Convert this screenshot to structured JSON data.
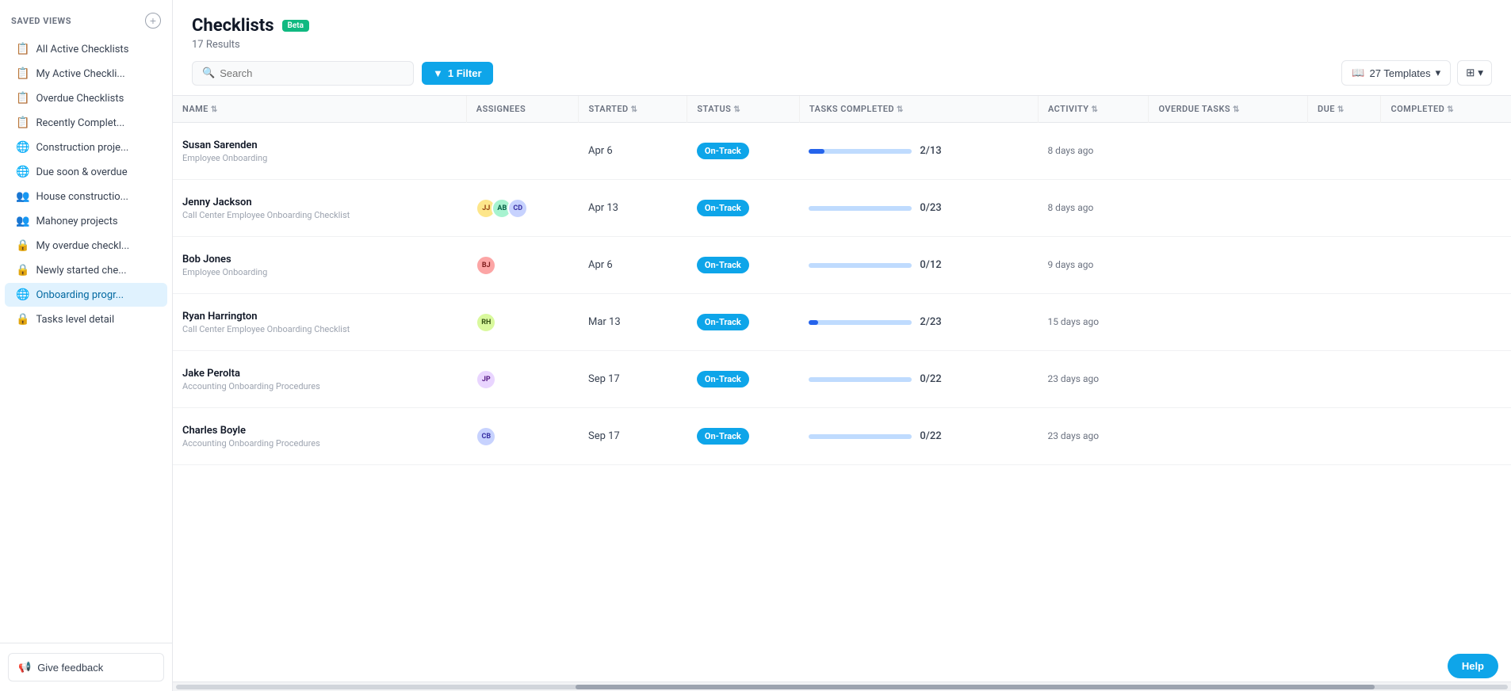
{
  "sidebar": {
    "header": "Saved Views",
    "add_icon": "+",
    "items": [
      {
        "id": "all-active",
        "label": "All Active Checklists",
        "icon": "📋",
        "active": false
      },
      {
        "id": "my-active",
        "label": "My Active Checkli...",
        "icon": "📋",
        "active": false
      },
      {
        "id": "overdue",
        "label": "Overdue Checklists",
        "icon": "📋",
        "active": false
      },
      {
        "id": "recently-completed",
        "label": "Recently Complet...",
        "icon": "📋",
        "active": false
      },
      {
        "id": "construction",
        "label": "Construction proje...",
        "icon": "🌐",
        "active": false
      },
      {
        "id": "due-soon",
        "label": "Due soon & overdue",
        "icon": "🌐",
        "active": false
      },
      {
        "id": "house-construction",
        "label": "House constructio...",
        "icon": "👥",
        "active": false
      },
      {
        "id": "mahoney",
        "label": "Mahoney projects",
        "icon": "👥",
        "active": false
      },
      {
        "id": "my-overdue",
        "label": "My overdue checkl...",
        "icon": "🔒",
        "active": false
      },
      {
        "id": "newly-started",
        "label": "Newly started che...",
        "icon": "🔒",
        "active": false
      },
      {
        "id": "onboarding",
        "label": "Onboarding progr...",
        "icon": "🌐",
        "active": true
      },
      {
        "id": "tasks-level",
        "label": "Tasks level detail",
        "icon": "🔒",
        "active": false
      }
    ],
    "feedback_label": "Give feedback"
  },
  "header": {
    "title": "Checklists",
    "beta_label": "Beta",
    "results": "17 Results",
    "search_placeholder": "Search",
    "filter_label": "1 Filter",
    "templates_label": "27 Templates",
    "view_icon": "⊞"
  },
  "table": {
    "columns": [
      {
        "id": "name",
        "label": "NAME",
        "sortable": true
      },
      {
        "id": "assignees",
        "label": "ASSIGNEES",
        "sortable": false
      },
      {
        "id": "started",
        "label": "STARTED",
        "sortable": true
      },
      {
        "id": "status",
        "label": "STATUS",
        "sortable": true
      },
      {
        "id": "tasks_completed",
        "label": "TASKS COMPLETED",
        "sortable": true
      },
      {
        "id": "activity",
        "label": "ACTIVITY",
        "sortable": true
      },
      {
        "id": "overdue_tasks",
        "label": "OVERDUE TASKS",
        "sortable": true
      },
      {
        "id": "due",
        "label": "DUE",
        "sortable": true
      },
      {
        "id": "completed",
        "label": "COMPLETED",
        "sortable": true
      }
    ],
    "rows": [
      {
        "id": "row1",
        "name": "Susan Sarenden",
        "sub": "Employee Onboarding",
        "assignees": [],
        "started": "Apr 6",
        "status": "On-Track",
        "tasks_done": 2,
        "tasks_total": 13,
        "progress_pct": 15,
        "activity": "8 days ago",
        "overdue": "",
        "due": "",
        "completed": ""
      },
      {
        "id": "row2",
        "name": "Jenny Jackson",
        "sub": "Call Center Employee Onboarding Checklist",
        "assignees": [
          "JJ",
          "AB",
          "CD"
        ],
        "av_colors": [
          "av1",
          "av2",
          "av3"
        ],
        "started": "Apr 13",
        "status": "On-Track",
        "tasks_done": 0,
        "tasks_total": 23,
        "progress_pct": 0,
        "activity": "8 days ago",
        "overdue": "",
        "due": "",
        "completed": ""
      },
      {
        "id": "row3",
        "name": "Bob Jones",
        "sub": "Employee Onboarding",
        "assignees": [
          "BJ"
        ],
        "av_colors": [
          "av4"
        ],
        "started": "Apr 6",
        "status": "On-Track",
        "tasks_done": 0,
        "tasks_total": 12,
        "progress_pct": 0,
        "activity": "9 days ago",
        "overdue": "",
        "due": "",
        "completed": ""
      },
      {
        "id": "row4",
        "name": "Ryan Harrington",
        "sub": "Call Center Employee Onboarding Checklist",
        "assignees": [
          "RH"
        ],
        "av_colors": [
          "av5"
        ],
        "started": "Mar 13",
        "status": "On-Track",
        "tasks_done": 2,
        "tasks_total": 23,
        "progress_pct": 9,
        "activity": "15 days ago",
        "overdue": "",
        "due": "",
        "completed": ""
      },
      {
        "id": "row5",
        "name": "Jake Perolta",
        "sub": "Accounting Onboarding Procedures",
        "assignees": [
          "JP"
        ],
        "av_colors": [
          "av6"
        ],
        "started": "Sep 17",
        "status": "On-Track",
        "tasks_done": 0,
        "tasks_total": 22,
        "progress_pct": 0,
        "activity": "23 days ago",
        "overdue": "",
        "due": "",
        "completed": ""
      },
      {
        "id": "row6",
        "name": "Charles Boyle",
        "sub": "Accounting Onboarding Procedures",
        "assignees": [
          "CB"
        ],
        "av_colors": [
          "av3"
        ],
        "started": "Sep 17",
        "status": "On-Track",
        "tasks_done": 0,
        "tasks_total": 22,
        "progress_pct": 0,
        "activity": "23 days ago",
        "overdue": "",
        "due": "",
        "completed": ""
      }
    ]
  },
  "help_label": "Help"
}
